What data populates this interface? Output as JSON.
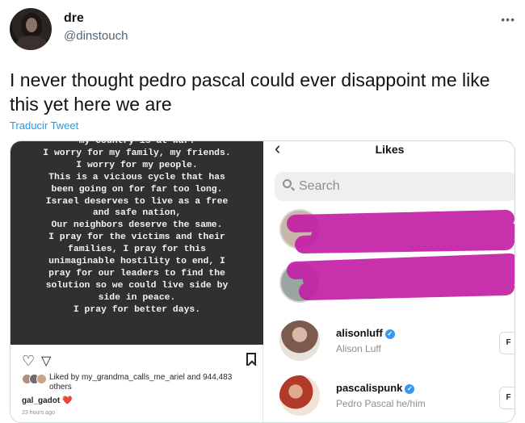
{
  "tweet": {
    "display_name": "dre",
    "handle": "@dinstouch",
    "more_icon": "more-horizontal-icon",
    "text": "I never thought pedro pascal could ever disappoint me like this yet here we are",
    "translate_label": "Traducir Tweet"
  },
  "media_left": {
    "statement_lines": [
      "my country is at war.",
      "I worry for my family, my friends.",
      "I worry for my people.",
      "This is a vicious cycle that has",
      "been going on for far too long.",
      "Israel deserves to live as a free",
      "and safe nation,",
      "Our neighbors deserve the same.",
      "I pray for the victims and their",
      "families, I pray for this",
      "unimaginable hostility to end, I",
      "pray for our leaders to find the",
      "solution so we could live side by",
      "side in peace.",
      "I pray for better days."
    ],
    "liked_by": "Liked by my_grandma_calls_me_ariel and 944,483 others",
    "username": "gal_gadot",
    "heart_emoji": "❤️",
    "timestamp": "23 hours ago"
  },
  "media_right": {
    "title": "Likes",
    "search_placeholder": "Search",
    "users": [
      {
        "username": "alisonluff",
        "full_name": "Alison Luff",
        "verified": true
      },
      {
        "username": "pascalispunk",
        "full_name": "Pedro Pascal he/him",
        "verified": true
      }
    ],
    "scribble_color": "#c21fa5"
  }
}
